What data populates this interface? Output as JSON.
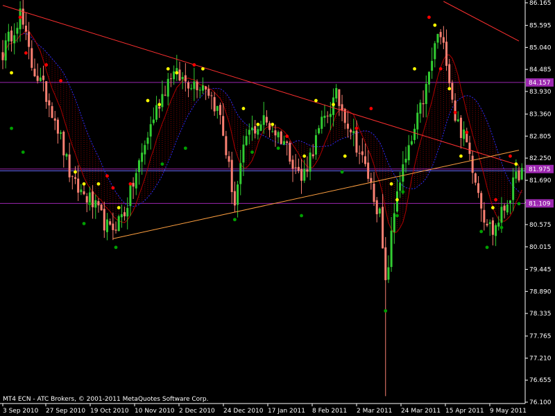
{
  "window": {
    "copyright": "MT4 ECN - ATC Brokers, © 2001-2011 MetaQuotes Software Corp."
  },
  "colors": {
    "background": "#000000",
    "axis": "#ffffff",
    "bull_candle": "#32cd32",
    "bear_candle": "#fa8072",
    "trendline": "#ff3030",
    "support_line": "#ffa040",
    "level_line": "#9c27b0",
    "level_label_bg": "#9c27b0",
    "blue_level": "#6a6aff",
    "ma_blue": "#2c2cff",
    "ma_red": "#b00000",
    "dot_red": "#ff0000",
    "dot_yellow": "#ffff00",
    "dot_green": "#00a000"
  },
  "chart_data": {
    "type": "candlestick",
    "title": "",
    "y_ticks": [
      "86.165",
      "85.595",
      "85.040",
      "84.485",
      "83.930",
      "83.360",
      "82.805",
      "82.250",
      "81.690",
      "81.135",
      "80.575",
      "80.015",
      "79.445",
      "78.890",
      "78.335",
      "77.765",
      "77.210",
      "76.655",
      "76.100"
    ],
    "ylim": [
      76.1,
      86.165
    ],
    "x_ticks": [
      "3 Sep 2010",
      "27 Sep 2010",
      "19 Oct 2010",
      "10 Nov 2010",
      "2 Dec 2010",
      "24 Dec 2010",
      "17 Jan 2011",
      "8 Feb 2011",
      "2 Mar 2011",
      "24 Mar 2011",
      "15 Apr 2011",
      "9 May 2011"
    ],
    "levels": [
      {
        "value": 84.157,
        "label": "84.157",
        "color": "#9c27b0"
      },
      {
        "value": 81.975,
        "label": "81.975",
        "color": "#9c27b0"
      },
      {
        "value": 81.109,
        "label": "81.109",
        "color": "#9c27b0"
      },
      {
        "value": 81.93,
        "label": "",
        "color": "#6a6aff"
      }
    ],
    "trendlines": [
      {
        "name": "resistance",
        "points": [
          [
            0,
            86.1
          ],
          [
            178,
            82.07
          ]
        ]
      },
      {
        "name": "support",
        "points": [
          [
            38,
            80.22
          ],
          [
            178,
            82.45
          ]
        ]
      },
      {
        "name": "upper",
        "points": [
          [
            152,
            86.2
          ],
          [
            178,
            85.2
          ]
        ]
      }
    ],
    "close_anchors": [
      [
        0,
        84.9
      ],
      [
        6,
        85.9
      ],
      [
        10,
        84.6
      ],
      [
        14,
        84.0
      ],
      [
        18,
        83.3
      ],
      [
        24,
        81.6
      ],
      [
        30,
        81.2
      ],
      [
        37,
        80.4
      ],
      [
        42,
        80.9
      ],
      [
        47,
        82.1
      ],
      [
        52,
        83.3
      ],
      [
        58,
        84.4
      ],
      [
        63,
        84.2
      ],
      [
        70,
        84.1
      ],
      [
        75,
        83.3
      ],
      [
        80,
        81.1
      ],
      [
        84,
        82.8
      ],
      [
        90,
        83.2
      ],
      [
        97,
        82.7
      ],
      [
        103,
        81.7
      ],
      [
        110,
        83.1
      ],
      [
        115,
        83.8
      ],
      [
        120,
        83.0
      ],
      [
        126,
        81.8
      ],
      [
        130,
        80.8
      ],
      [
        132,
        79.0
      ],
      [
        136,
        81.5
      ],
      [
        140,
        82.4
      ],
      [
        146,
        84.0
      ],
      [
        150,
        85.4
      ],
      [
        153,
        84.8
      ],
      [
        156,
        83.3
      ],
      [
        160,
        82.6
      ],
      [
        163,
        81.8
      ],
      [
        166,
        80.8
      ],
      [
        169,
        80.4
      ],
      [
        173,
        81.0
      ],
      [
        178,
        81.9
      ]
    ],
    "signal_dots": [
      {
        "i": 3,
        "v": 84.4,
        "color": "yellow"
      },
      {
        "i": 6,
        "v": 85.8,
        "color": "red"
      },
      {
        "i": 8,
        "v": 84.9,
        "color": "red"
      },
      {
        "i": 3,
        "v": 83.0,
        "color": "green"
      },
      {
        "i": 7,
        "v": 82.4,
        "color": "green"
      },
      {
        "i": 15,
        "v": 84.6,
        "color": "red"
      },
      {
        "i": 20,
        "v": 84.2,
        "color": "red"
      },
      {
        "i": 25,
        "v": 81.9,
        "color": "yellow"
      },
      {
        "i": 28,
        "v": 81.6,
        "color": "yellow"
      },
      {
        "i": 30,
        "v": 81.1,
        "color": "green"
      },
      {
        "i": 33,
        "v": 81.6,
        "color": "yellow"
      },
      {
        "i": 36,
        "v": 81.8,
        "color": "red"
      },
      {
        "i": 38,
        "v": 81.5,
        "color": "red"
      },
      {
        "i": 40,
        "v": 81.0,
        "color": "yellow"
      },
      {
        "i": 39,
        "v": 80.0,
        "color": "green"
      },
      {
        "i": 44,
        "v": 81.6,
        "color": "red"
      },
      {
        "i": 28,
        "v": 80.6,
        "color": "green"
      },
      {
        "i": 50,
        "v": 83.7,
        "color": "yellow"
      },
      {
        "i": 54,
        "v": 83.6,
        "color": "yellow"
      },
      {
        "i": 57,
        "v": 84.5,
        "color": "yellow"
      },
      {
        "i": 60,
        "v": 84.4,
        "color": "yellow"
      },
      {
        "i": 66,
        "v": 84.6,
        "color": "red"
      },
      {
        "i": 69,
        "v": 84.5,
        "color": "yellow"
      },
      {
        "i": 55,
        "v": 82.1,
        "color": "green"
      },
      {
        "i": 63,
        "v": 82.5,
        "color": "green"
      },
      {
        "i": 83,
        "v": 83.5,
        "color": "yellow"
      },
      {
        "i": 88,
        "v": 83.1,
        "color": "yellow"
      },
      {
        "i": 93,
        "v": 83.1,
        "color": "yellow"
      },
      {
        "i": 98,
        "v": 82.8,
        "color": "red"
      },
      {
        "i": 95,
        "v": 82.5,
        "color": "green"
      },
      {
        "i": 80,
        "v": 80.7,
        "color": "green"
      },
      {
        "i": 86,
        "v": 82.4,
        "color": "green"
      },
      {
        "i": 103,
        "v": 80.8,
        "color": "green"
      },
      {
        "i": 108,
        "v": 83.7,
        "color": "yellow"
      },
      {
        "i": 114,
        "v": 83.6,
        "color": "yellow"
      },
      {
        "i": 118,
        "v": 82.3,
        "color": "yellow"
      },
      {
        "i": 122,
        "v": 83.0,
        "color": "red"
      },
      {
        "i": 127,
        "v": 83.5,
        "color": "red"
      },
      {
        "i": 117,
        "v": 81.9,
        "color": "green"
      },
      {
        "i": 104,
        "v": 82.3,
        "color": "yellow"
      },
      {
        "i": 132,
        "v": 78.4,
        "color": "green"
      },
      {
        "i": 134,
        "v": 81.6,
        "color": "yellow"
      },
      {
        "i": 136,
        "v": 81.2,
        "color": "yellow"
      },
      {
        "i": 136,
        "v": 80.8,
        "color": "green"
      },
      {
        "i": 138,
        "v": 81.4,
        "color": "green"
      },
      {
        "i": 142,
        "v": 84.5,
        "color": "yellow"
      },
      {
        "i": 147,
        "v": 85.8,
        "color": "red"
      },
      {
        "i": 149,
        "v": 85.6,
        "color": "yellow"
      },
      {
        "i": 151,
        "v": 84.5,
        "color": "red"
      },
      {
        "i": 154,
        "v": 84.0,
        "color": "yellow"
      },
      {
        "i": 156,
        "v": 83.4,
        "color": "red"
      },
      {
        "i": 160,
        "v": 82.9,
        "color": "red"
      },
      {
        "i": 158,
        "v": 82.3,
        "color": "yellow"
      },
      {
        "i": 165,
        "v": 80.4,
        "color": "green"
      },
      {
        "i": 167,
        "v": 80.0,
        "color": "green"
      },
      {
        "i": 169,
        "v": 81.0,
        "color": "yellow"
      },
      {
        "i": 170,
        "v": 81.2,
        "color": "red"
      },
      {
        "i": 172,
        "v": 80.5,
        "color": "green"
      },
      {
        "i": 175,
        "v": 82.3,
        "color": "red"
      },
      {
        "i": 177,
        "v": 82.1,
        "color": "yellow"
      },
      {
        "i": 178,
        "v": 81.1,
        "color": "green"
      }
    ]
  }
}
